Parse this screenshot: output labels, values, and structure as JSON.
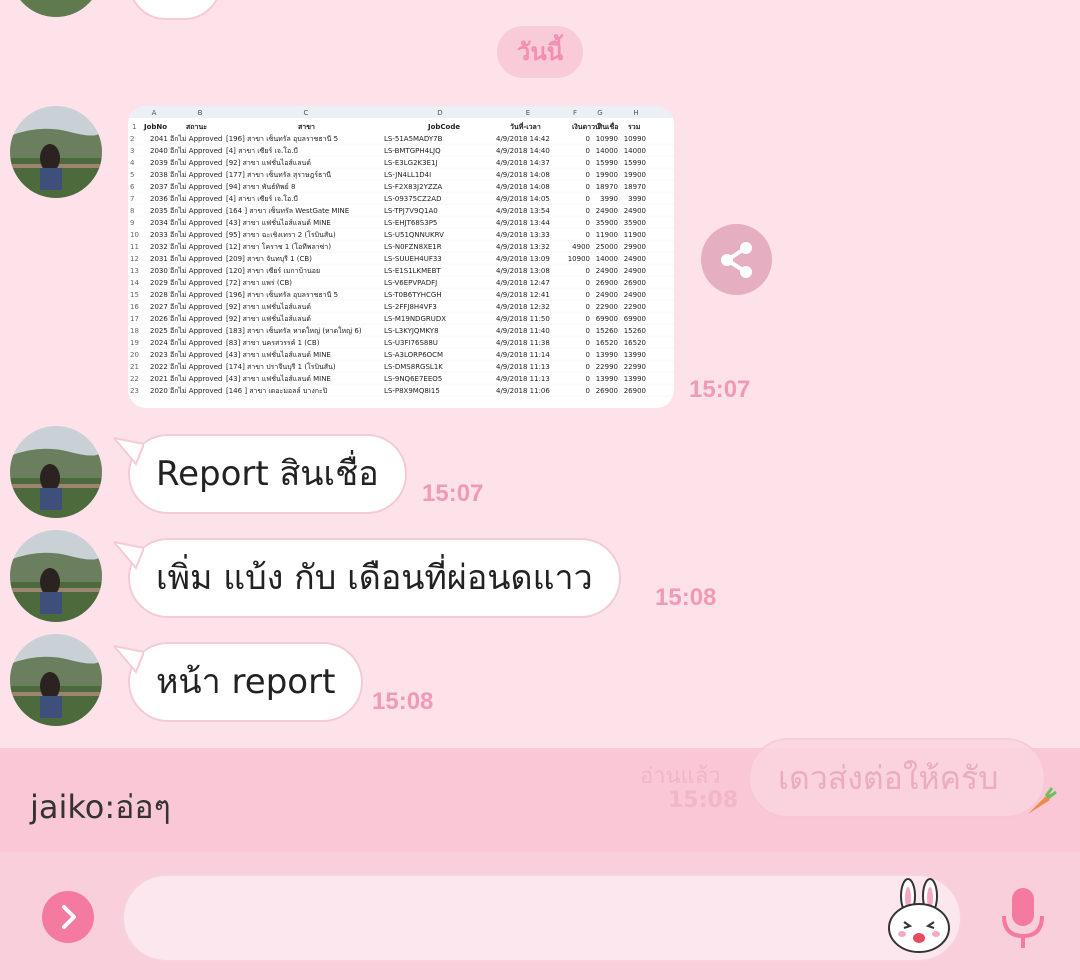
{
  "date_separator": "วันนี้",
  "image_message": {
    "time": "15:07",
    "spreadsheet": {
      "col_letters": [
        "A",
        "B",
        "C",
        "D",
        "E",
        "F",
        "G",
        "H"
      ],
      "headers": [
        "JobNo",
        "สถานะ",
        "สาขา",
        "JobCode",
        "วันที่-เวลา",
        "เงินดาวน์",
        "สินเชื่อ",
        "รวม"
      ],
      "rows": [
        [
          "2041",
          "อีกไม่ Approved",
          "[196] สาขา เซ็นทรัล อุบลราชธานี 5",
          "LS-51A5MADY7B",
          "4/9/2018 14:42",
          "0",
          "10990",
          "10990"
        ],
        [
          "2040",
          "อีกไม่ Approved",
          "[4] สาขา เซียร์ เจ.โอ.บี",
          "LS-BMTGPH4LJQ",
          "4/9/2018 14:40",
          "0",
          "14000",
          "14000"
        ],
        [
          "2039",
          "อีกไม่ Approved",
          "[92] สาขา แฟชั่นไอส์แลนด์",
          "LS-E3LG2K3E1J",
          "4/9/2018 14:37",
          "0",
          "15990",
          "15990"
        ],
        [
          "2038",
          "อีกไม่ Approved",
          "[177] สาขา เซ็นทรัล สุราษฎร์ธานี",
          "LS-JN4LL1D4I",
          "4/9/2018 14:08",
          "0",
          "19900",
          "19900"
        ],
        [
          "2037",
          "อีกไม่ Approved",
          "[94] สาขา พันธ์ทิพย์ 8",
          "LS-F2X83J2YZZA",
          "4/9/2018 14:08",
          "0",
          "18970",
          "18970"
        ],
        [
          "2036",
          "อีกไม่ Approved",
          "[4] สาขา เซียร์ เจ.โอ.บี",
          "LS-09375CZ2AD",
          "4/9/2018 14:05",
          "0",
          "3990",
          "3990"
        ],
        [
          "2035",
          "อีกไม่ Approved",
          "[164 ] สาขา เซ็นทรัล WestGate MINE",
          "LS-TPJ7V9Q1A0",
          "4/9/2018 13:54",
          "0",
          "24900",
          "24900"
        ],
        [
          "2034",
          "อีกไม่ Approved",
          "[43] สาขา แฟชั่นไอส์แลนด์ MINE",
          "LS-EHJT68S3P5",
          "4/9/2018 13:44",
          "0",
          "35900",
          "35900"
        ],
        [
          "2033",
          "อีกไม่ Approved",
          "[95] สาขา ฉะเชิงเทรา 2 (โรบินสัน)",
          "LS-U51QNNUKRV",
          "4/9/2018 13:33",
          "0",
          "11900",
          "11900"
        ],
        [
          "2032",
          "อีกไม่ Approved",
          "[12] สาขา โคราช 1 (โอทีพลาซ่า)",
          "LS-N0FZN8XE1R",
          "4/9/2018 13:32",
          "4900",
          "25000",
          "29900"
        ],
        [
          "2031",
          "อีกไม่ Approved",
          "[209] สาขา จันทบุรี 1 (CB)",
          "LS-SUUEH4UF33",
          "4/9/2018 13:09",
          "10900",
          "14000",
          "24900"
        ],
        [
          "2030",
          "อีกไม่ Approved",
          "[120] สาขา เซียร์ เมกาบ้านอย",
          "LS-E1S1LKMEBT",
          "4/9/2018 13:08",
          "0",
          "24900",
          "24900"
        ],
        [
          "2029",
          "อีกไม่ Approved",
          "[72] สาขา แพร่ (CB)",
          "LS-V6EPVPADFJ",
          "4/9/2018 12:47",
          "0",
          "26900",
          "26900"
        ],
        [
          "2028",
          "อีกไม่ Approved",
          "[196] สาขา เซ็นทรัล อุบลราชธานี 5",
          "LS-T0B6TYHCGH",
          "4/9/2018 12:41",
          "0",
          "24900",
          "24900"
        ],
        [
          "2027",
          "อีกไม่ Approved",
          "[92] สาขา แฟชั่นไอส์แลนด์",
          "LS-2FFJ8H4VF3",
          "4/9/2018 12:32",
          "0",
          "22900",
          "22900"
        ],
        [
          "2026",
          "อีกไม่ Approved",
          "[92] สาขา แฟชั่นไอส์แลนด์",
          "LS-M19NDGRUDX",
          "4/9/2018 11:50",
          "0",
          "69900",
          "69900"
        ],
        [
          "2025",
          "อีกไม่ Approved",
          "[183] สาขา เซ็นทรัล หาดใหญ่ (หาดใหญ่ 6)",
          "LS-L3KYJQMKY8",
          "4/9/2018 11:40",
          "0",
          "15260",
          "15260"
        ],
        [
          "2024",
          "อีกไม่ Approved",
          "[83] สาขา นครสวรรค์ 1 (CB)",
          "LS-U3FI76S88U",
          "4/9/2018 11:38",
          "0",
          "16520",
          "16520"
        ],
        [
          "2023",
          "อีกไม่ Approved",
          "[43] สาขา แฟชั่นไอส์แลนด์ MINE",
          "LS-A3LORP6OCM",
          "4/9/2018 11:14",
          "0",
          "13990",
          "13990"
        ],
        [
          "2022",
          "อีกไม่ Approved",
          "[174] สาขา ปราจีนบุรี 1 (โรบินสัน)",
          "LS-DMS8RGSL1K",
          "4/9/2018 11:13",
          "0",
          "22990",
          "22990"
        ],
        [
          "2021",
          "อีกไม่ Approved",
          "[43] สาขา แฟชั่นไอส์แลนด์ MINE",
          "LS-9NQ6E7EEO5",
          "4/9/2018 11:13",
          "0",
          "13990",
          "13990"
        ],
        [
          "2020",
          "อีกไม่ Approved",
          "[146 ] สาขา เดอะมอลล์ บางกะปิ",
          "LS-P8X9MQ8I15",
          "4/9/2018 11:06",
          "0",
          "26900",
          "26900"
        ]
      ]
    }
  },
  "messages": [
    {
      "text": "Report สินเชื่อ",
      "time": "15:07"
    },
    {
      "text": "เพิ่ม แบ้ง กับ เดือนที่ผ่อนดแาว",
      "time": "15:08"
    },
    {
      "text": "หน้า report",
      "time": "15:08"
    }
  ],
  "composer_preview": {
    "text": "jaiko:อ่อๆ",
    "ghost_bubble_text": "เดวส่งต่อให้ครับ",
    "ghost_read": "อ่านแล้ว",
    "ghost_time": "15:08"
  },
  "icons": {
    "share": "share-icon",
    "plus": "chevron-right-icon",
    "sticker": "bunny-sticker-icon",
    "mic": "microphone-icon"
  },
  "colors": {
    "chat_bg": "#fde2ea",
    "time_pink": "#f09ab8",
    "accent_pink": "#f47aa0"
  }
}
